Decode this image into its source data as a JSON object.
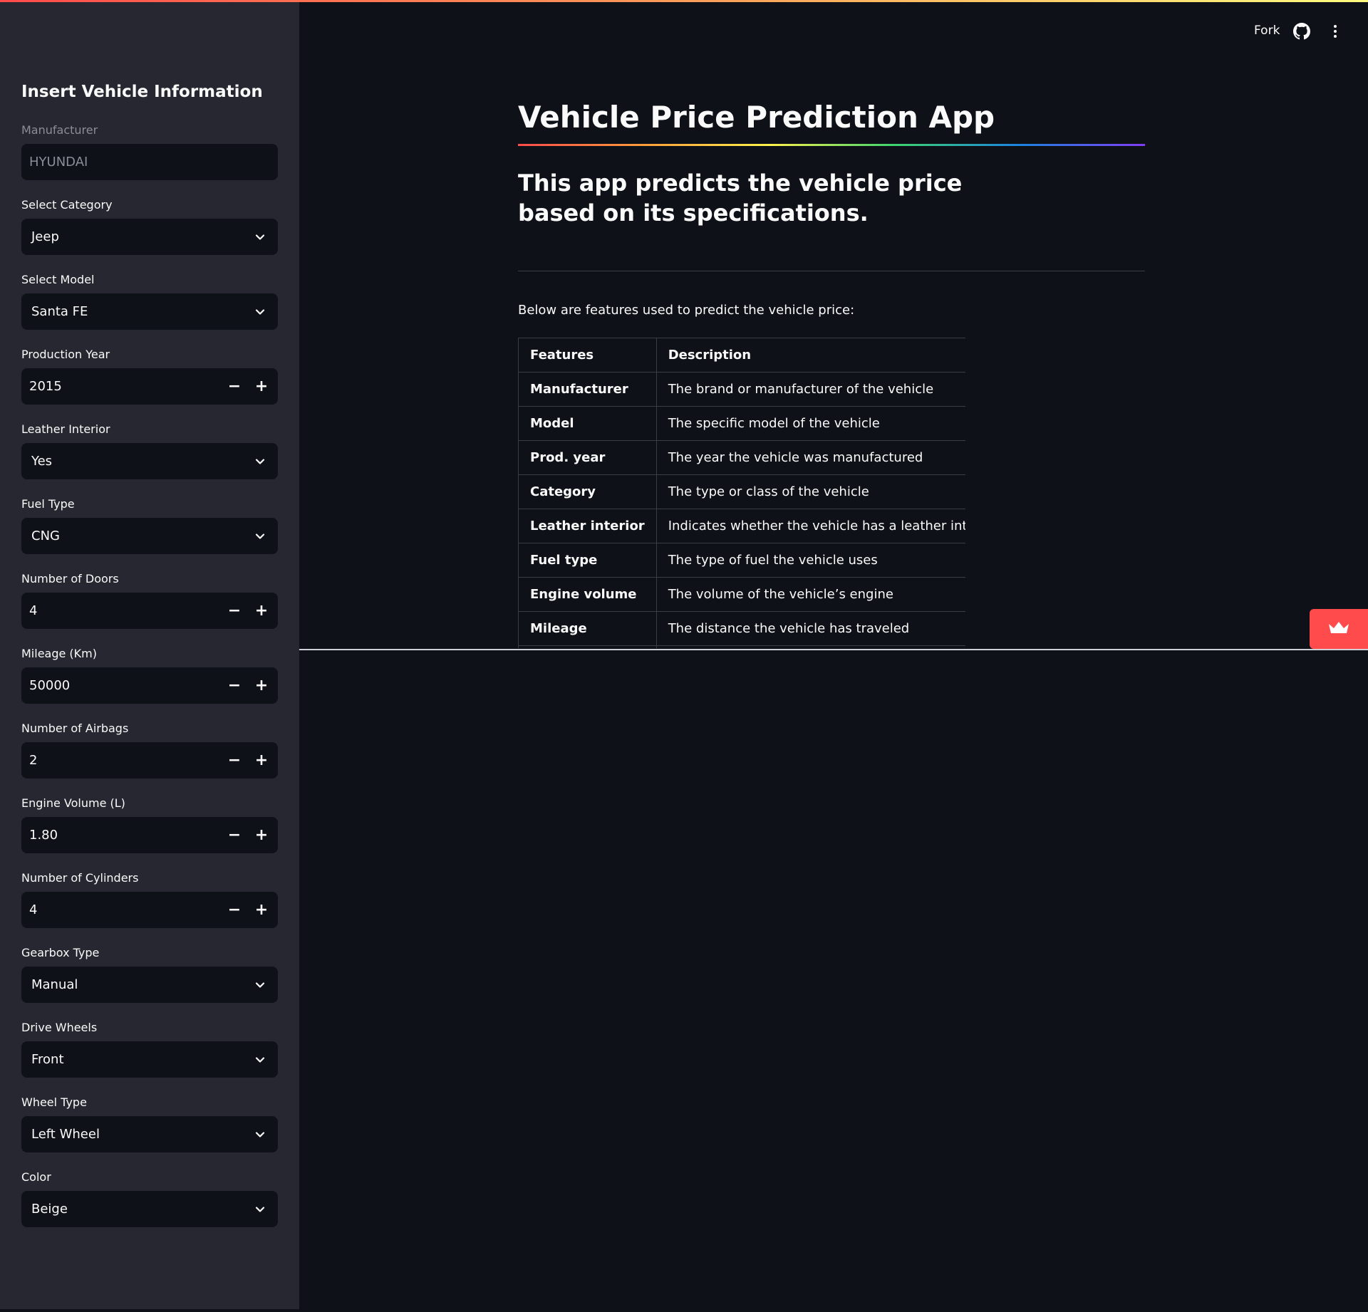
{
  "header": {
    "fork_label": "Fork"
  },
  "sidebar": {
    "title": "Insert Vehicle Information",
    "fields": [
      {
        "label": "Manufacturer",
        "value": "HYUNDAI",
        "kind": "disabled-text"
      },
      {
        "label": "Select Category",
        "value": "Jeep",
        "kind": "select"
      },
      {
        "label": "Select Model",
        "value": "Santa FE",
        "kind": "select"
      },
      {
        "label": "Production Year",
        "value": "2015",
        "kind": "number"
      },
      {
        "label": "Leather Interior",
        "value": "Yes",
        "kind": "select"
      },
      {
        "label": "Fuel Type",
        "value": "CNG",
        "kind": "select"
      },
      {
        "label": "Number of Doors",
        "value": "4",
        "kind": "number"
      },
      {
        "label": "Mileage (Km)",
        "value": "50000",
        "kind": "number"
      },
      {
        "label": "Number of Airbags",
        "value": "2",
        "kind": "number"
      },
      {
        "label": "Engine Volume (L)",
        "value": "1.80",
        "kind": "number"
      },
      {
        "label": "Number of Cylinders",
        "value": "4",
        "kind": "number"
      },
      {
        "label": "Gearbox Type",
        "value": "Manual",
        "kind": "select"
      },
      {
        "label": "Drive Wheels",
        "value": "Front",
        "kind": "select"
      },
      {
        "label": "Wheel Type",
        "value": "Left Wheel",
        "kind": "select"
      },
      {
        "label": "Color",
        "value": "Beige",
        "kind": "select"
      }
    ]
  },
  "main": {
    "title": "Vehicle Price Prediction App",
    "subtitle": "This app predicts the vehicle price based on its specifications.",
    "intro": "Below are features used to predict the vehicle price:",
    "table": {
      "headers": [
        "Features",
        "Description"
      ],
      "rows": [
        [
          "Manufacturer",
          "The brand or manufacturer of the vehicle"
        ],
        [
          "Model",
          "The specific model of the vehicle"
        ],
        [
          "Prod. year",
          "The year the vehicle was manufactured"
        ],
        [
          "Category",
          "The type or class of the vehicle"
        ],
        [
          "Leather interior",
          "Indicates whether the vehicle has a leather interior"
        ],
        [
          "Fuel type",
          "The type of fuel the vehicle uses"
        ],
        [
          "Engine volume",
          "The volume of the vehicle’s engine"
        ],
        [
          "Mileage",
          "The distance the vehicle has traveled"
        ]
      ]
    }
  },
  "colors": {
    "app_background": "#0e1117",
    "sidebar_background": "#262730",
    "accent": "#ff4b4b"
  },
  "icons": {
    "header": [
      "github-icon",
      "more-vert-icon"
    ],
    "select": "chevron-down-icon",
    "badge": "crown-icon"
  }
}
